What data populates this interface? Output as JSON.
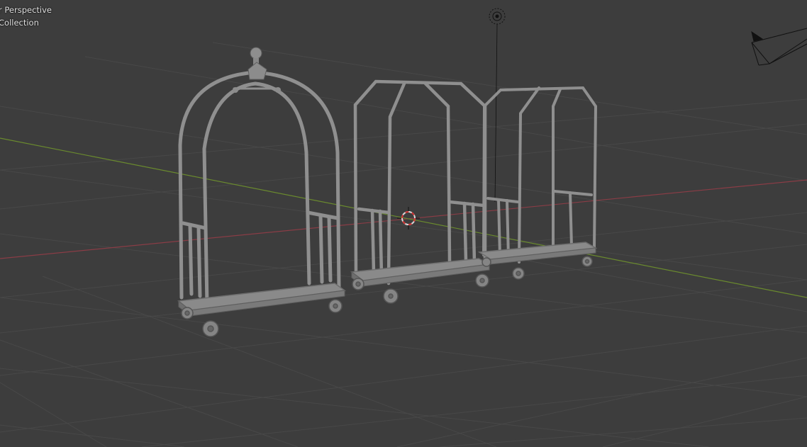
{
  "viewport": {
    "view_label": "r Perspective",
    "collection_label": "Collection"
  },
  "colors": {
    "background": "#3d3d3d",
    "grid_line": "#4a4a4a",
    "x_axis": "#8a3d46",
    "y_axis": "#6a8a2e",
    "model": "#9a9a9a",
    "model_edge": "#6e6e6e"
  },
  "icons": {
    "cursor": "3d-cursor-icon",
    "light": "light-icon",
    "camera": "camera-icon"
  }
}
